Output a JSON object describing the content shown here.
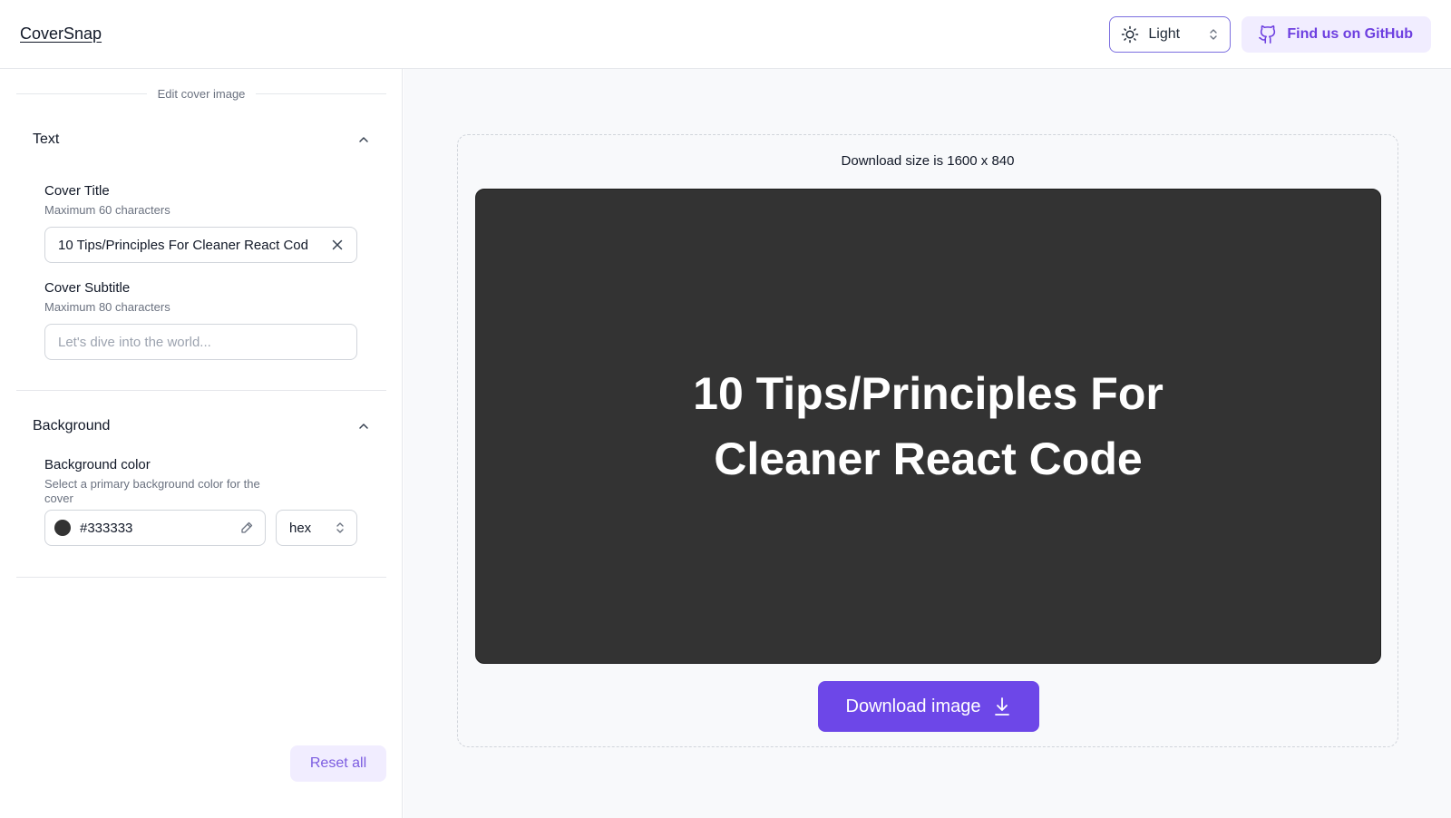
{
  "header": {
    "brand": "CoverSnap",
    "theme_select": {
      "value": "Light",
      "icon": "sun-icon"
    },
    "github_button": {
      "label": "Find us on GitHub",
      "icon": "github-icon"
    }
  },
  "sidebar": {
    "title": "Edit cover image",
    "sections": {
      "text": {
        "label": "Text",
        "cover_title": {
          "label": "Cover Title",
          "help": "Maximum 60 characters",
          "value": "10 Tips/Principles For Cleaner React Cod"
        },
        "cover_subtitle": {
          "label": "Cover Subtitle",
          "help": "Maximum 80 characters",
          "placeholder": "Let's dive into the world..."
        }
      },
      "background": {
        "label": "Background",
        "color": {
          "label": "Background color",
          "help": "Select a primary background color for the cover",
          "value": "#333333",
          "format": "hex"
        }
      }
    },
    "reset_label": "Reset all"
  },
  "preview": {
    "size_label": "Download size is 1600 x 840",
    "cover_title": "10 Tips/Principles For Cleaner React Code",
    "background_color": "#333333",
    "download_label": "Download image"
  },
  "colors": {
    "accent": "#6d47e8",
    "accent_soft": "#f1edff"
  }
}
